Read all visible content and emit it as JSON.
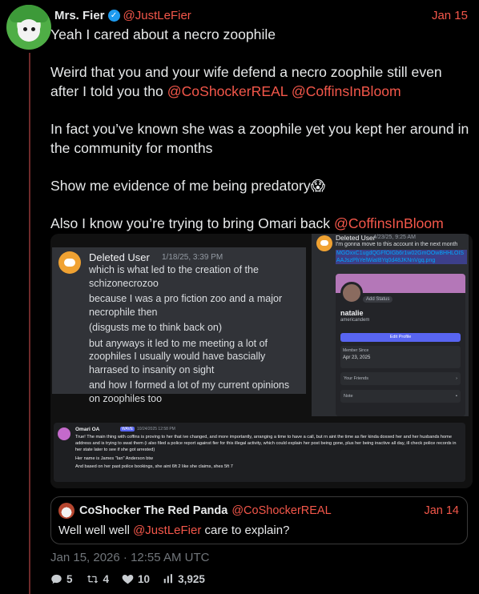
{
  "post": {
    "display_name": "Mrs. Fier",
    "handle": "@JustLeFier",
    "date": "Jan 15",
    "line1": "Yeah I cared about a necro zoophile",
    "para2_text": "Weird that you and your wife defend a necro zoophile still even after I told you tho ",
    "para2_mention1": "@CoShockerREAL",
    "para2_mention2": "@CoffinsInBloom",
    "para3": "In fact you’ve known she was a zoophile yet you kept her around in the community for months",
    "para4_text": "Show me evidence of me being predatory",
    "para4_emoji": "😱",
    "para5_text": "Also I know you’re trying to bring Omari back ",
    "para5_mention": "@CoffinsInBloom",
    "timestamp": "Jan 15, 2026 · 12:55 AM UTC"
  },
  "media": {
    "dm1": {
      "username": "Deleted User",
      "time": "1/18/25, 3:39 PM",
      "lines": [
        "which is what led to the creation of the schizonecrozoo",
        "because I was a pro fiction zoo and a major necrophile then",
        "(disgusts me to think back on)",
        "but anyways it led to me meeting a lot of zoophiles I usually would have bascially harrased to insanity on sight",
        "and how I formed a lot of my current opinions on zoophiles too"
      ]
    },
    "dm2": {
      "username": "Deleted User",
      "time": "4/23/25, 9:25 AM",
      "message": "I'm gonna move to this account in the next month",
      "link": "MGOxxC1ugdQGFfOIGb6r1w02GmOOwBHHLOISAAJszPhYelWiaIBYq0d48JKNnVgq.png",
      "add_status": "Add Status",
      "profile_name": "natalie",
      "profile_tag": "americandem",
      "edit_profile": "Edit Profile",
      "member_since_label": "Member Since",
      "member_since": "Apr 23, 2025",
      "your_friends": "Your Friends",
      "note": "Note"
    },
    "dm3": {
      "username": "Omari OA",
      "badge": "WAVE",
      "time": "10/24/2025 12:58 PM",
      "lines": [
        "True! The main thing with coffins is proving to her that ive changed, and more importantly, arranging a time to have a call, but rn aint the time as fier kinda doxxed her and her husbands home address and is trying to swat them (i also filed a police report against fier for this illegal activity, which could explain her post being gone, plus her being inactive all day, ill check police records in her state later to see if she got arrested)",
        "Her name is James \"Ian\" Anderson btw",
        "And based on her past police bookings, she aint 6ft 2 like she claims, shes 5ft 7"
      ]
    }
  },
  "quote": {
    "display_name": "CoShocker The Red Panda",
    "handle": "@CoShockerREAL",
    "date": "Jan 14",
    "text_before": "Well well well ",
    "mention": "@JustLeFier",
    "text_after": " care to explain?"
  },
  "stats": {
    "replies": "5",
    "reposts": "4",
    "likes": "10",
    "views": "3,925"
  },
  "colors": {
    "accent": "#f4574a",
    "background": "#000000",
    "verified": "#1d9bf0"
  },
  "icons": [
    "verified-icon",
    "reply-icon",
    "repost-icon",
    "like-icon",
    "views-icon",
    "discord-icon"
  ]
}
